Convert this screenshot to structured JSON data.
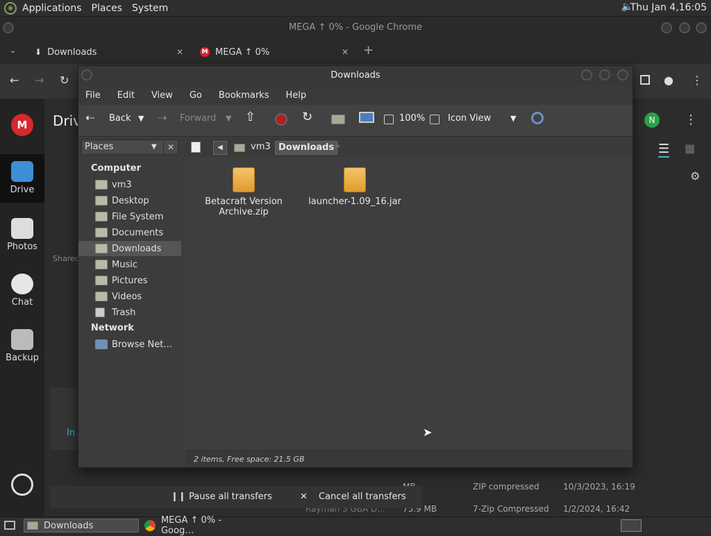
{
  "top_panel": {
    "menus": [
      "Applications",
      "Places",
      "System"
    ],
    "clock": "Thu Jan  4,16:05"
  },
  "chrome": {
    "title": "MEGA ↑ 0% - Google Chrome",
    "tabs": [
      {
        "label": "Downloads"
      },
      {
        "label": "MEGA ↑ 0%"
      }
    ],
    "new_tab": "+",
    "partial_heading": "Driv",
    "avatar_letter": "N"
  },
  "mega_sidebar": {
    "items": [
      {
        "label": "Drive"
      },
      {
        "label": "Photos"
      },
      {
        "label": "Chat"
      },
      {
        "label": "Backup"
      }
    ],
    "shared_label": "Shared"
  },
  "nautilus": {
    "title": "Downloads",
    "menu": [
      "File",
      "Edit",
      "View",
      "Go",
      "Bookmarks",
      "Help"
    ],
    "toolbar": {
      "back": "Back",
      "forward": "Forward",
      "zoom": "100%",
      "view_mode": "Icon View"
    },
    "places_label": "Places",
    "path": [
      "vm3",
      "Downloads"
    ],
    "sidebar": {
      "computer_heading": "Computer",
      "computer_items": [
        "vm3",
        "Desktop",
        "File System",
        "Documents",
        "Downloads",
        "Music",
        "Pictures",
        "Videos",
        "Trash"
      ],
      "network_heading": "Network",
      "network_items": [
        "Browse Net…"
      ]
    },
    "files": [
      {
        "name_line1": "Betacraft Version",
        "name_line2": "Archive.zip"
      },
      {
        "name_line1": "launcher-1.09_16.jar",
        "name_line2": ""
      }
    ],
    "status": "2 items, Free space: 21.5 GB"
  },
  "transfers": {
    "pause": "Pause all transfers",
    "cancel": "Cancel all transfers",
    "in_label": "In"
  },
  "bg_rows": [
    {
      "size": "MB",
      "type": "ZIP compressed",
      "date": "10/3/2023, 16:19"
    },
    {
      "name": "Rayman 3 GBA D...",
      "size": "75.9 MB",
      "type": "7-Zip Compressed",
      "date": "1/2/2024, 16:42"
    }
  ],
  "taskbar": {
    "items": [
      "Downloads",
      "MEGA ↑ 0% - Goog…"
    ]
  }
}
